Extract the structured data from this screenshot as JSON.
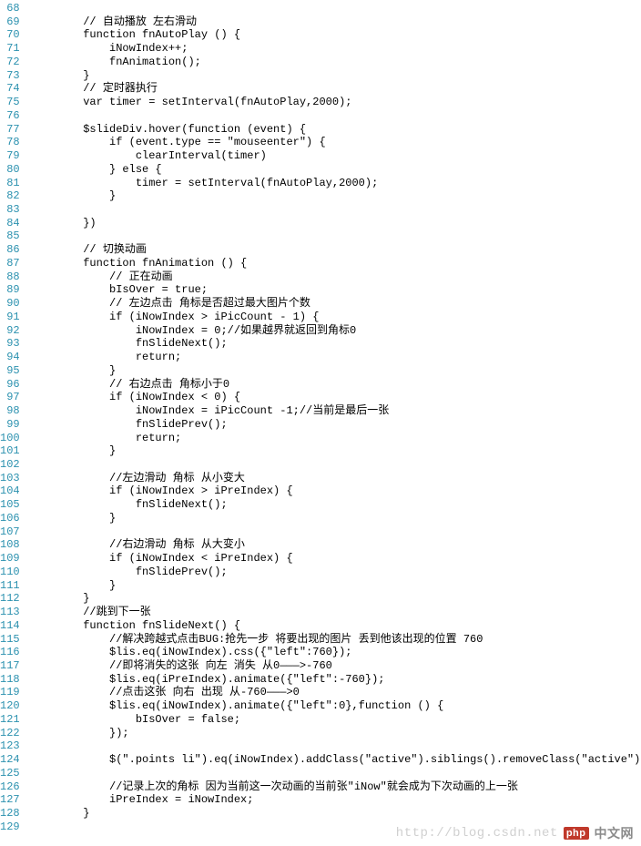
{
  "line_start": 68,
  "line_end": 129,
  "lines": [
    "",
    "        // 自动播放 左右滑动",
    "        function fnAutoPlay () {",
    "            iNowIndex++;",
    "            fnAnimation();",
    "        }",
    "        // 定时器执行",
    "        var timer = setInterval(fnAutoPlay,2000);",
    "",
    "        $slideDiv.hover(function (event) {",
    "            if (event.type == \"mouseenter\") {",
    "                clearInterval(timer)",
    "            } else {",
    "                timer = setInterval(fnAutoPlay,2000);",
    "            }",
    "",
    "        })",
    "",
    "        // 切换动画",
    "        function fnAnimation () {",
    "            // 正在动画",
    "            bIsOver = true;",
    "            // 左边点击 角标是否超过最大图片个数",
    "            if (iNowIndex > iPicCount - 1) {",
    "                iNowIndex = 0;//如果越界就返回到角标0",
    "                fnSlideNext();",
    "                return;",
    "            }",
    "            // 右边点击 角标小于0",
    "            if (iNowIndex < 0) {",
    "                iNowIndex = iPicCount -1;//当前是最后一张",
    "                fnSlidePrev();",
    "                return;",
    "            }",
    "",
    "            //左边滑动 角标 从小变大",
    "            if (iNowIndex > iPreIndex) {",
    "                fnSlideNext();",
    "            }",
    "",
    "            //右边滑动 角标 从大变小",
    "            if (iNowIndex < iPreIndex) {",
    "                fnSlidePrev();",
    "            }",
    "        }",
    "        //跳到下一张",
    "        function fnSlideNext() {",
    "            //解决跨越式点击BUG:抢先一步 将要出现的图片 丢到他该出现的位置 760",
    "            $lis.eq(iNowIndex).css({\"left\":760});",
    "            //即将消失的这张 向左 消失 从0———>-760",
    "            $lis.eq(iPreIndex).animate({\"left\":-760});",
    "            //点击这张 向右 出现 从-760———>0",
    "            $lis.eq(iNowIndex).animate({\"left\":0},function () {",
    "                bIsOver = false;",
    "            });",
    "",
    "            $(\".points li\").eq(iNowIndex).addClass(\"active\").siblings().removeClass(\"active\");",
    "",
    "            //记录上次的角标 因为当前这一次动画的当前张\"iNow\"就会成为下次动画的上一张",
    "            iPreIndex = iNowIndex;",
    "        }",
    ""
  ],
  "watermark": {
    "url_prefix": "http://blog.csdn.net",
    "badge": "php",
    "site": "中文网"
  }
}
